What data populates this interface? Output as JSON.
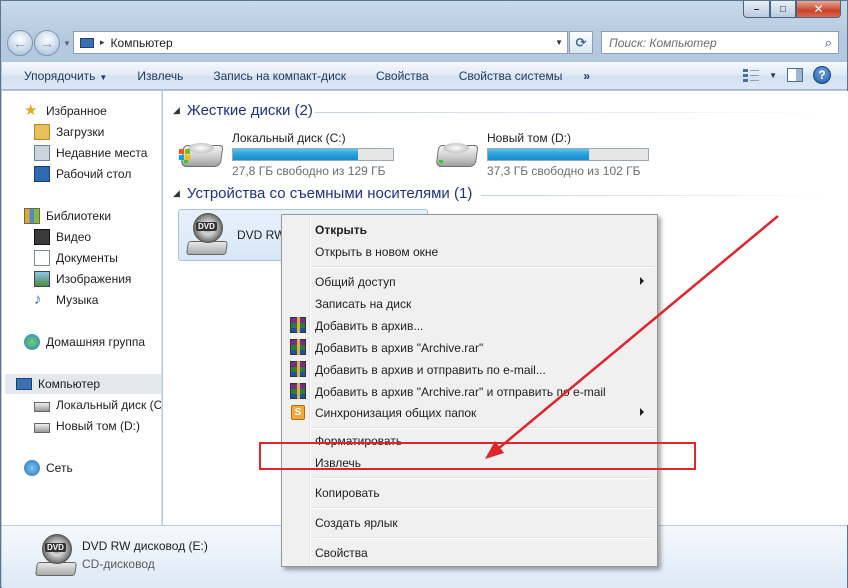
{
  "window": {
    "caption": {
      "min": "–",
      "max": "□",
      "close": "✕"
    }
  },
  "address": {
    "separator": "▸",
    "crumb": "Компьютер",
    "search_placeholder": "Поиск: Компьютер"
  },
  "toolbar": {
    "organize": "Упорядочить",
    "eject": "Извлечь",
    "burn": "Запись на компакт-диск",
    "properties": "Свойства",
    "system_properties": "Свойства системы",
    "more": "»",
    "help": "?"
  },
  "nav": {
    "favorites": "Избранное",
    "downloads": "Загрузки",
    "recent": "Недавние места",
    "desktop": "Рабочий стол",
    "libraries": "Библиотеки",
    "video": "Видео",
    "documents": "Документы",
    "images": "Изображения",
    "music": "Музыка",
    "homegroup": "Домашняя группа",
    "computer": "Компьютер",
    "local_c": "Локальный диск (С",
    "new_d": "Новый том (D:)",
    "network": "Сеть"
  },
  "content": {
    "hard_drives_header": "Жесткие диски (2)",
    "removable_header": "Устройства со съемными носителями (1)",
    "drives": [
      {
        "name": "Локальный диск (C:)",
        "free": "27,8 ГБ свободно из 129 ГБ",
        "used_fraction": 0.78
      },
      {
        "name": "Новый том (D:)",
        "free": "37,3 ГБ свободно из 102 ГБ",
        "used_fraction": 0.63
      }
    ],
    "dvd_name": "DVD RW",
    "dvd_icon_label": "DVD"
  },
  "details": {
    "name": "DVD RW дисковод (E:)",
    "type": "CD-дисковод"
  },
  "context_menu": {
    "open": "Открыть",
    "open_new_window": "Открыть в новом окне",
    "share": "Общий доступ",
    "burn_disc": "Записать на диск",
    "add_archive": "Добавить в архив...",
    "add_archive_rar": "Добавить в архив \"Archive.rar\"",
    "add_archive_email": "Добавить в архив и отправить по e-mail...",
    "add_archive_rar_email": "Добавить в архив \"Archive.rar\" и отправить по e-mail",
    "sync": "Синхронизация общих папок",
    "format": "Форматировать",
    "eject": "Извлечь",
    "copy": "Копировать",
    "create_shortcut": "Создать ярлык",
    "properties": "Свойства"
  },
  "annotation": {
    "color": "#e0242c"
  }
}
